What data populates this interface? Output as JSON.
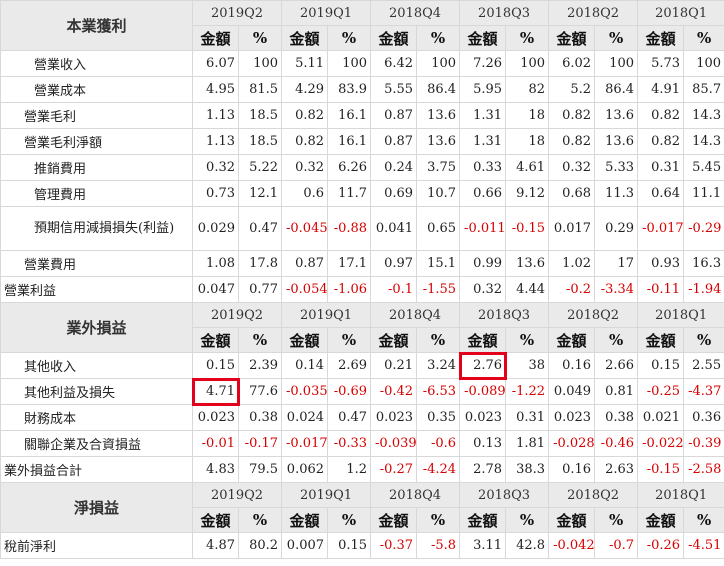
{
  "quarters": [
    "2019Q2",
    "2019Q1",
    "2018Q4",
    "2018Q3",
    "2018Q2",
    "2018Q1"
  ],
  "sub_headers": {
    "amount": "金額",
    "percent": "%"
  },
  "sections": [
    {
      "title": "本業獲利",
      "rows": [
        {
          "label": "營業收入",
          "indent": 1,
          "cells": [
            "6.07",
            "100",
            "5.11",
            "100",
            "6.42",
            "100",
            "7.26",
            "100",
            "6.02",
            "100",
            "5.73",
            "100"
          ]
        },
        {
          "label": "營業成本",
          "indent": 1,
          "cells": [
            "4.95",
            "81.5",
            "4.29",
            "83.9",
            "5.55",
            "86.4",
            "5.95",
            "82",
            "5.2",
            "86.4",
            "4.91",
            "85.7"
          ]
        },
        {
          "label": "營業毛利",
          "indent": 2,
          "cells": [
            "1.13",
            "18.5",
            "0.82",
            "16.1",
            "0.87",
            "13.6",
            "1.31",
            "18",
            "0.82",
            "13.6",
            "0.82",
            "14.3"
          ]
        },
        {
          "label": "營業毛利淨額",
          "indent": 2,
          "cells": [
            "1.13",
            "18.5",
            "0.82",
            "16.1",
            "0.87",
            "13.6",
            "1.31",
            "18",
            "0.82",
            "13.6",
            "0.82",
            "14.3"
          ]
        },
        {
          "label": "推銷費用",
          "indent": 1,
          "cells": [
            "0.32",
            "5.22",
            "0.32",
            "6.26",
            "0.24",
            "3.75",
            "0.33",
            "4.61",
            "0.32",
            "5.33",
            "0.31",
            "5.45"
          ]
        },
        {
          "label": "管理費用",
          "indent": 1,
          "cells": [
            "0.73",
            "12.1",
            "0.6",
            "11.7",
            "0.69",
            "10.7",
            "0.66",
            "9.12",
            "0.68",
            "11.3",
            "0.64",
            "11.1"
          ]
        },
        {
          "label": "預期信用減損損失(利益)",
          "indent": 1,
          "wrap": true,
          "cells": [
            "0.029",
            "0.47",
            "-0.045",
            "-0.88",
            "0.041",
            "0.65",
            "-0.011",
            "-0.15",
            "0.017",
            "0.29",
            "-0.017",
            "-0.29"
          ]
        },
        {
          "label": "營業費用",
          "indent": 2,
          "cells": [
            "1.08",
            "17.8",
            "0.87",
            "17.1",
            "0.97",
            "15.1",
            "0.99",
            "13.6",
            "1.02",
            "17",
            "0.93",
            "16.3"
          ]
        },
        {
          "label": "營業利益",
          "indent": 3,
          "cells": [
            "0.047",
            "0.77",
            "-0.054",
            "-1.06",
            "-0.1",
            "-1.55",
            "0.32",
            "4.44",
            "-0.2",
            "-3.34",
            "-0.11",
            "-1.94"
          ]
        }
      ]
    },
    {
      "title": "業外損益",
      "rows": [
        {
          "label": "其他收入",
          "indent": 2,
          "cells": [
            "0.15",
            "2.39",
            "0.14",
            "2.69",
            "0.21",
            "3.24",
            "2.76",
            "38",
            "0.16",
            "2.66",
            "0.15",
            "2.55"
          ],
          "highlight": [
            6
          ]
        },
        {
          "label": "其他利益及損失",
          "indent": 2,
          "cells": [
            "4.71",
            "77.6",
            "-0.035",
            "-0.69",
            "-0.42",
            "-6.53",
            "-0.089",
            "-1.22",
            "0.049",
            "0.81",
            "-0.25",
            "-4.37"
          ],
          "highlight": [
            0
          ]
        },
        {
          "label": "財務成本",
          "indent": 2,
          "cells": [
            "0.023",
            "0.38",
            "0.024",
            "0.47",
            "0.023",
            "0.35",
            "0.023",
            "0.31",
            "0.023",
            "0.38",
            "0.021",
            "0.36"
          ]
        },
        {
          "label": "關聯企業及合資損益",
          "indent": 2,
          "cells": [
            "-0.01",
            "-0.17",
            "-0.017",
            "-0.33",
            "-0.039",
            "-0.6",
            "0.13",
            "1.81",
            "-0.028",
            "-0.46",
            "-0.022",
            "-0.39"
          ]
        },
        {
          "label": "業外損益合計",
          "indent": 3,
          "cells": [
            "4.83",
            "79.5",
            "0.062",
            "1.2",
            "-0.27",
            "-4.24",
            "2.78",
            "38.3",
            "0.16",
            "2.63",
            "-0.15",
            "-2.58"
          ]
        }
      ]
    },
    {
      "title": "淨損益",
      "rows": [
        {
          "label": "稅前淨利",
          "indent": 3,
          "cells": [
            "4.87",
            "80.2",
            "0.007",
            "0.15",
            "-0.37",
            "-5.8",
            "3.11",
            "42.8",
            "-0.042",
            "-0.7",
            "-0.26",
            "-4.51"
          ]
        }
      ]
    }
  ]
}
